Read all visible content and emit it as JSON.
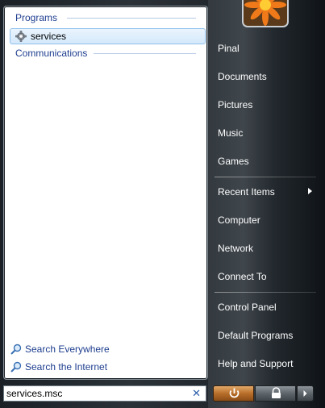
{
  "left": {
    "sections": {
      "programs": "Programs",
      "communications": "Communications"
    },
    "result_item": {
      "label": "services"
    },
    "search_links": [
      "Search Everywhere",
      "Search the Internet"
    ]
  },
  "search": {
    "value": "services.msc"
  },
  "right": {
    "items": [
      {
        "label": "Pinal"
      },
      {
        "label": "Documents"
      },
      {
        "label": "Pictures"
      },
      {
        "label": "Music"
      },
      {
        "label": "Games"
      },
      {
        "label": "Recent Items"
      },
      {
        "label": "Computer"
      },
      {
        "label": "Network"
      },
      {
        "label": "Connect To"
      },
      {
        "label": "Control Panel"
      },
      {
        "label": "Default Programs"
      },
      {
        "label": "Help and Support"
      }
    ]
  },
  "icons": {
    "result_item": "gear-icon",
    "search_links": "magnifier-icon",
    "clear": "clear-icon",
    "power": "power-icon",
    "lock": "lock-icon",
    "menu": "arrow-right-icon"
  },
  "colors": {
    "accent": "#1e3e8f",
    "selection": "#d4e9fb",
    "power": "#b86e2a"
  }
}
